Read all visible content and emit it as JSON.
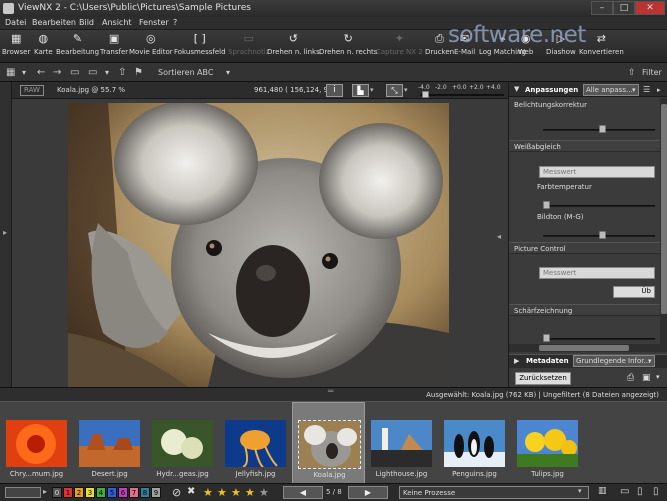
{
  "window": {
    "title": "ViewNX 2 - C:\\Users\\Public\\Pictures\\Sample Pictures",
    "min": "–",
    "max": "□",
    "close": "✕"
  },
  "menu": [
    "Datei",
    "Bearbeiten",
    "Bild",
    "Ansicht",
    "Fenster",
    "?"
  ],
  "toolbar": [
    {
      "label": "Browser",
      "icon": "browser-icon",
      "glyph": "▦"
    },
    {
      "label": "Karte",
      "icon": "globe-icon",
      "glyph": "◍"
    },
    {
      "label": "Bearbeitung",
      "icon": "pencil-icon",
      "glyph": "✎"
    },
    {
      "label": "Transfer",
      "icon": "camera-icon",
      "glyph": "▣"
    },
    {
      "label": "Movie Editor",
      "icon": "movie-icon",
      "glyph": "◎"
    },
    {
      "label": "Fokusmessfeld",
      "icon": "focus-bracket-icon",
      "glyph": "[ ]"
    },
    {
      "label": "Sprachnotiz",
      "icon": "voice-memo-icon",
      "glyph": "▭",
      "disabled": true
    },
    {
      "label": "Drehen n. links",
      "icon": "rotate-left-icon",
      "glyph": "↺"
    },
    {
      "label": "Drehen n. rechts",
      "icon": "rotate-right-icon",
      "glyph": "↻"
    },
    {
      "label": "Capture NX 2",
      "icon": "capture-icon",
      "glyph": "✦",
      "disabled": true
    },
    {
      "label": "Drucken",
      "icon": "printer-icon",
      "glyph": "⎙"
    },
    {
      "label": "E-Mail",
      "icon": "mail-icon",
      "glyph": "✉"
    },
    {
      "label": "Log Matching",
      "icon": "log-icon",
      "glyph": "⌁"
    },
    {
      "label": "Web",
      "icon": "web-icon",
      "glyph": "◉"
    },
    {
      "label": "Diashow",
      "icon": "slideshow-icon",
      "glyph": "▷"
    },
    {
      "label": "Konvertieren",
      "icon": "convert-icon",
      "glyph": "⇄"
    }
  ],
  "watermark": "software.net",
  "secondary": {
    "sort_label": "Sortieren",
    "sort_value": "ABC",
    "filter": "Filter"
  },
  "viewer": {
    "raw_badge": "RAW",
    "filename_zoom": "Koala.jpg @ 55.7 %",
    "pixel_readout": "961,480 ( 156,124, 91 )",
    "ev_ticks": [
      "-4.0",
      "-2.0",
      "+0.0",
      "+2.0",
      "+4.0"
    ]
  },
  "panel": {
    "tab": "Anpassungen",
    "preset": "Alle anpass...",
    "exposure": "Belichtungskorrektur",
    "white_balance": "Weißabgleich",
    "wb_value": "Messwert",
    "color_temp": "Farbtemperatur",
    "tint": "Bildton (M-G)",
    "picture_control": "Picture Control",
    "pc_value": "Messwert",
    "button_u": "Üb",
    "sharpening": "Schärfzeichnung",
    "metadata_tab": "Metadaten",
    "metadata_value": "Grundlegende Infor...",
    "reset": "Zurücksetzen"
  },
  "status": "Ausgewählt: Koala.jpg (762 KB) | Ungefiltert (8 Dateien angezeigt)",
  "thumbnails": [
    "Chry...mum.jpg",
    "Desert.jpg",
    "Hydr...geas.jpg",
    "Jellyfish.jpg",
    "Koala.jpg",
    "Lighthouse.jpg",
    "Penguins.jpg",
    "Tulips.jpg"
  ],
  "selected_index": 4,
  "bottom": {
    "labels": [
      "0",
      "1",
      "2",
      "3",
      "4",
      "5",
      "6",
      "7",
      "8",
      "9"
    ],
    "page": "5 / 8",
    "process": "Keine Prozesse"
  }
}
